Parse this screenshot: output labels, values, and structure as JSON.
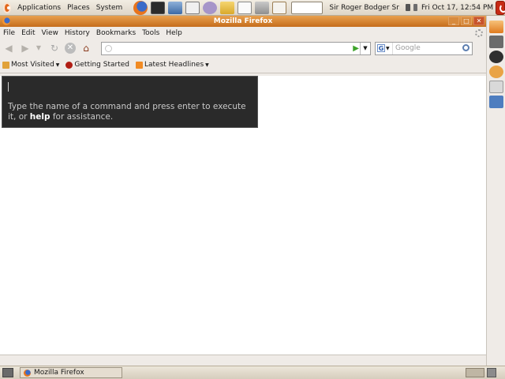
{
  "top_panel": {
    "menus": [
      "Applications",
      "Places",
      "System"
    ],
    "launcher_icons": [
      "firefox-icon",
      "terminal-icon",
      "network-icon",
      "mail-icon",
      "pidgin-icon",
      "folder-icon",
      "text-editor-icon",
      "calculator-icon",
      "dictionary-icon"
    ],
    "user_name": "Sir Roger Bodger Sr",
    "clock": "Fri Oct 17, 12:54 PM"
  },
  "firefox": {
    "title": "Mozilla Firefox",
    "window_buttons": [
      "_",
      "□",
      "✕"
    ],
    "menus": [
      "File",
      "Edit",
      "View",
      "History",
      "Bookmarks",
      "Tools",
      "Help"
    ],
    "nav": {
      "back": "◀",
      "forward": "▶",
      "history_drop": "▼",
      "reload": "↻",
      "stop": "✕",
      "home": "⌂",
      "url_value": "",
      "go": "▶",
      "url_drop": "▼"
    },
    "search": {
      "engine_letter": "G",
      "engine_drop": "▼",
      "placeholder": "Google"
    },
    "bookmarks": [
      {
        "label": "Most Visited",
        "caret": "▼"
      },
      {
        "label": "Getting Started",
        "caret": ""
      },
      {
        "label": "Latest Headlines",
        "caret": "▼"
      }
    ],
    "command_panel": {
      "line_pre": "Type the name of a command and press enter to execute it, or ",
      "line_bold": "help",
      "line_post": " for assistance."
    }
  },
  "bottom_panel": {
    "taskbar_item": "Mozilla Firefox"
  },
  "colors": {
    "panel_bg": "#e2dbcf",
    "titlebar": "#d8853a",
    "command_bg": "#2a2a2a",
    "command_text": "#c9c9c9"
  }
}
